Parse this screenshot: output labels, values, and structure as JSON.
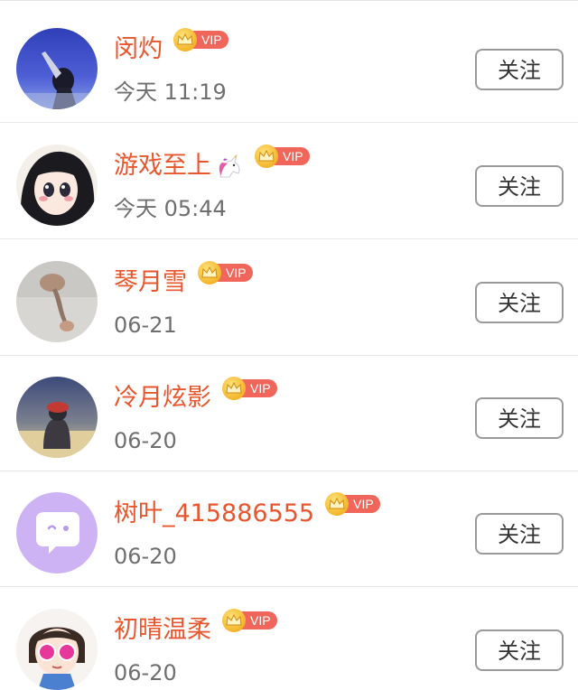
{
  "follow_label": "关注",
  "vip_label": "VIP",
  "users": [
    {
      "name": "闵灼",
      "time": "今天 11:19",
      "avatar": "photo-silhouette-blue",
      "name_emoji": ""
    },
    {
      "name": "游戏至上",
      "time": "今天 05:44",
      "avatar": "anime-girl",
      "name_emoji": "unicorn-emoji"
    },
    {
      "name": "琴月雪",
      "time": "06-21",
      "avatar": "photo-gray",
      "name_emoji": ""
    },
    {
      "name": "冷月炫影",
      "time": "06-20",
      "avatar": "photo-red-hat",
      "name_emoji": ""
    },
    {
      "name": "树叶_415886555",
      "time": "06-20",
      "avatar": "default-chat-bubble",
      "name_emoji": ""
    },
    {
      "name": "初晴温柔",
      "time": "06-20",
      "avatar": "cartoon-girl-pink-glasses",
      "name_emoji": ""
    }
  ],
  "colors": {
    "name": "#e8562d",
    "time": "#6f6f6f",
    "vip_tag": "#f0665a",
    "crown": "#f3b52a",
    "button_border": "#9a9a9a"
  }
}
